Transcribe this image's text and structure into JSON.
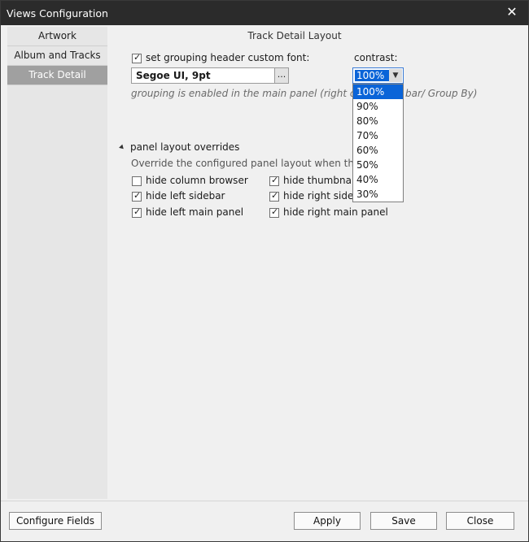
{
  "window": {
    "title": "Views Configuration"
  },
  "sidebar": {
    "items": [
      {
        "label": "Artwork"
      },
      {
        "label": "Album and Tracks"
      },
      {
        "label": "Track Detail"
      }
    ]
  },
  "main": {
    "section_title": "Track Detail Layout",
    "grouping": {
      "label": "set grouping header custom font:",
      "checked": true,
      "font_value": "Segoe UI, 9pt",
      "browse_label": "...",
      "hint": "grouping is enabled in the main panel (right click on",
      "hint_tail": "bar/ Group By)"
    },
    "contrast": {
      "label": "contrast:",
      "selected": "100%",
      "options": [
        "100%",
        "90%",
        "80%",
        "70%",
        "60%",
        "50%",
        "40%",
        "30%"
      ]
    },
    "overrides": {
      "title": "panel layout overrides",
      "description": "Override the configured panel layout when the view",
      "checkboxes": [
        {
          "label": "hide column browser",
          "checked": false
        },
        {
          "label": "hide thumbnail",
          "checked": true
        },
        {
          "label": "hide left sidebar",
          "checked": true
        },
        {
          "label": "hide right sideba",
          "checked": true
        },
        {
          "label": "hide left main panel",
          "checked": true
        },
        {
          "label": "hide right main panel",
          "checked": true
        }
      ]
    }
  },
  "footer": {
    "configure_fields": "Configure Fields",
    "apply": "Apply",
    "save": "Save",
    "close": "Close"
  }
}
